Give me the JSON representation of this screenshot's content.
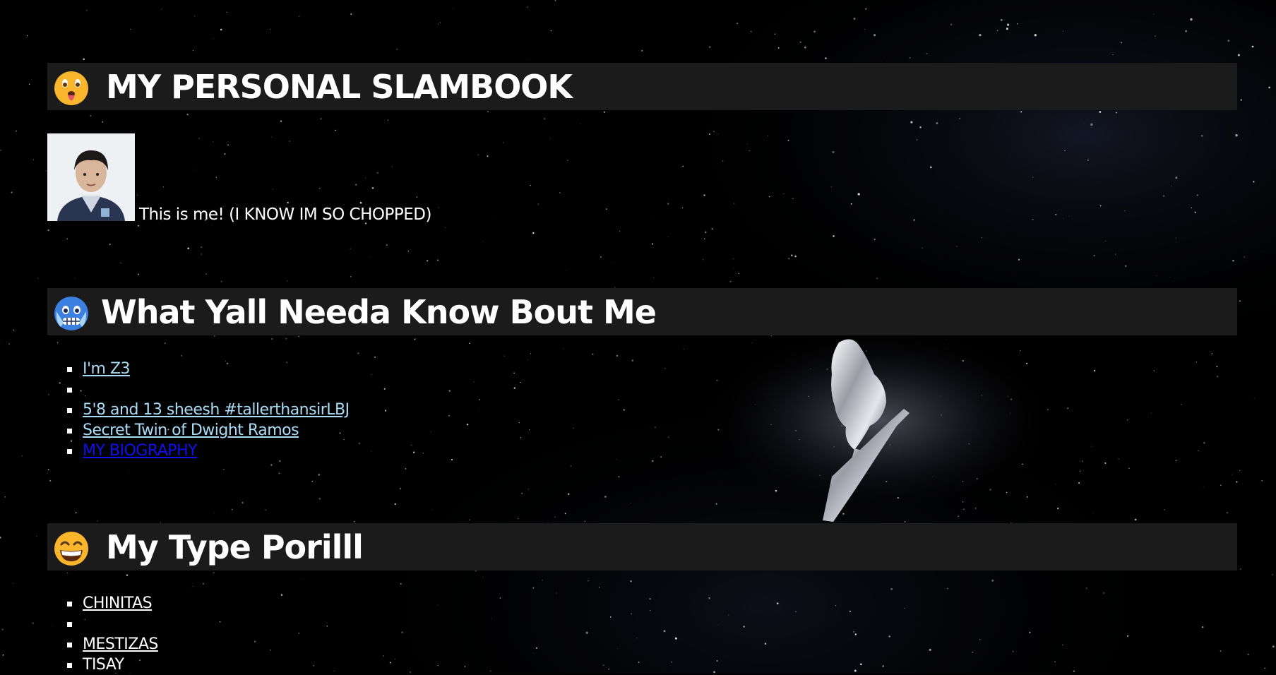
{
  "sections": [
    {
      "title": "MY PERSONAL SLAMBOOK",
      "icon": "tongue-out-emoji-icon"
    },
    {
      "title": "What Yall Needa Know Bout Me",
      "icon": "cold-face-emoji-icon"
    },
    {
      "title": "My Type Porilll",
      "icon": "grinning-emoji-icon"
    }
  ],
  "profile": {
    "caption": "This is me! (I KNOW IM SO CHOPPED)",
    "photo": "profile-photo"
  },
  "about_list": [
    {
      "text": "I'm Z3",
      "style": "link-light"
    },
    {
      "text": "",
      "style": "plain"
    },
    {
      "text": "5'8 and 13 sheesh #tallerthansirLBJ",
      "style": "link-light"
    },
    {
      "text": "Secret Twin of Dwight Ramos",
      "style": "link-light"
    },
    {
      "text": "MY BIOGRAPHY",
      "style": "link-blue"
    }
  ],
  "type_list": [
    {
      "text": "CHINITAS",
      "style": "link-white"
    },
    {
      "text": "",
      "style": "plain"
    },
    {
      "text": "MESTIZAS",
      "style": "link-white"
    },
    {
      "text": "TISAY",
      "style": "plain"
    }
  ],
  "colors": {
    "background": "#000000",
    "section_bar": "#1b1b1b",
    "link_light": "#a9dcf7",
    "link_visited_blue": "#1010ee",
    "text": "#ffffff"
  },
  "decor": {
    "surfer_image": "silver-surfer-image"
  }
}
